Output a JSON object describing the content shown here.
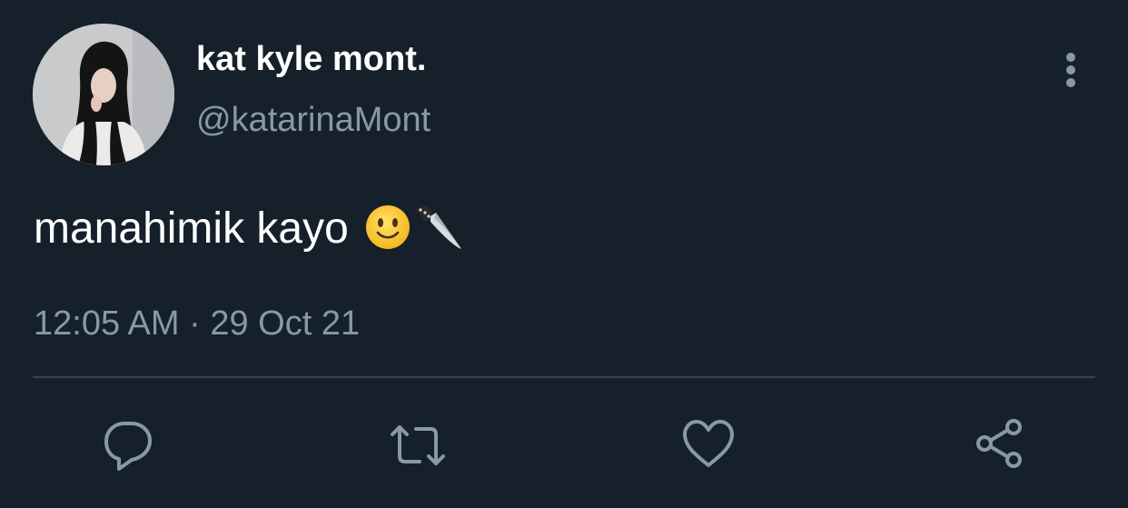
{
  "tweet": {
    "display_name": "kat kyle mont.",
    "handle": "@katarinaMont",
    "text": "manahimik kayo",
    "emojis": [
      "slightly-smiling-face-emoji",
      "kitchen-knife-emoji"
    ],
    "timestamp": "12:05 AM · 29 Oct 21"
  },
  "actions": [
    {
      "icon": "reply-icon"
    },
    {
      "icon": "retweet-icon"
    },
    {
      "icon": "like-icon"
    },
    {
      "icon": "share-icon"
    }
  ],
  "colors": {
    "background": "#15202b",
    "primary_text": "#ffffff",
    "secondary_text": "#8899a6",
    "divider": "#38444d"
  }
}
